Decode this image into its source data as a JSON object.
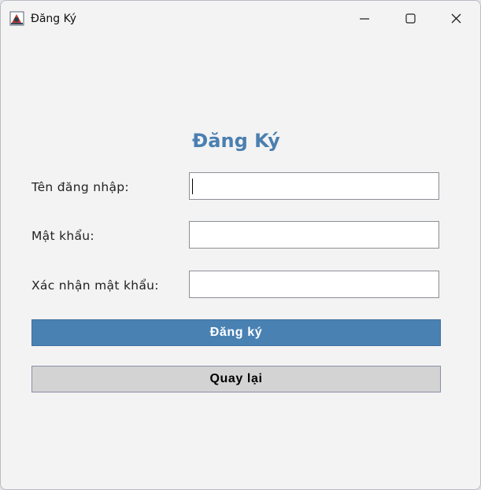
{
  "window": {
    "title": "Đăng Ký"
  },
  "form": {
    "heading": "Đăng Ký",
    "username_label": "Tên đăng nhập:",
    "username_value": "",
    "password_label": "Mật khẩu:",
    "password_value": "",
    "confirm_label": "Xác nhận mật khẩu:",
    "confirm_value": "",
    "register_button": "Đăng ký",
    "back_button": "Quay lại"
  },
  "colors": {
    "accent": "#4a7fb0",
    "primary_button": "#4981b3",
    "secondary_button": "#d3d3d3",
    "background": "#f3f3f4"
  },
  "icons": {
    "app": "java-app-icon",
    "minimize": "minimize-icon",
    "maximize": "maximize-icon",
    "close": "close-icon"
  }
}
